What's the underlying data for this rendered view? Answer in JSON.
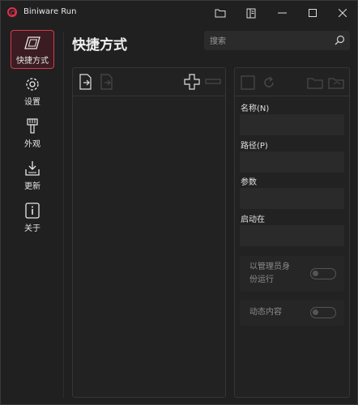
{
  "app": {
    "title": "Biniware Run"
  },
  "sidebar": {
    "items": [
      {
        "label": "快捷方式",
        "icon": "shortcut-icon",
        "active": true
      },
      {
        "label": "设置",
        "icon": "gear-icon"
      },
      {
        "label": "外观",
        "icon": "brush-icon"
      },
      {
        "label": "更新",
        "icon": "download-icon"
      },
      {
        "label": "关于",
        "icon": "info-icon"
      }
    ]
  },
  "header": {
    "title": "快捷方式",
    "search_placeholder": "搜索"
  },
  "form": {
    "name_label": "名称(N)",
    "path_label": "路径(P)",
    "args_label": "参数",
    "startin_label": "启动在",
    "admin_label_line1": "以管理员身",
    "admin_label_line2": "份运行",
    "dynamic_label": "动态内容"
  },
  "colors": {
    "accent": "#e0304a",
    "background": "#202020"
  }
}
